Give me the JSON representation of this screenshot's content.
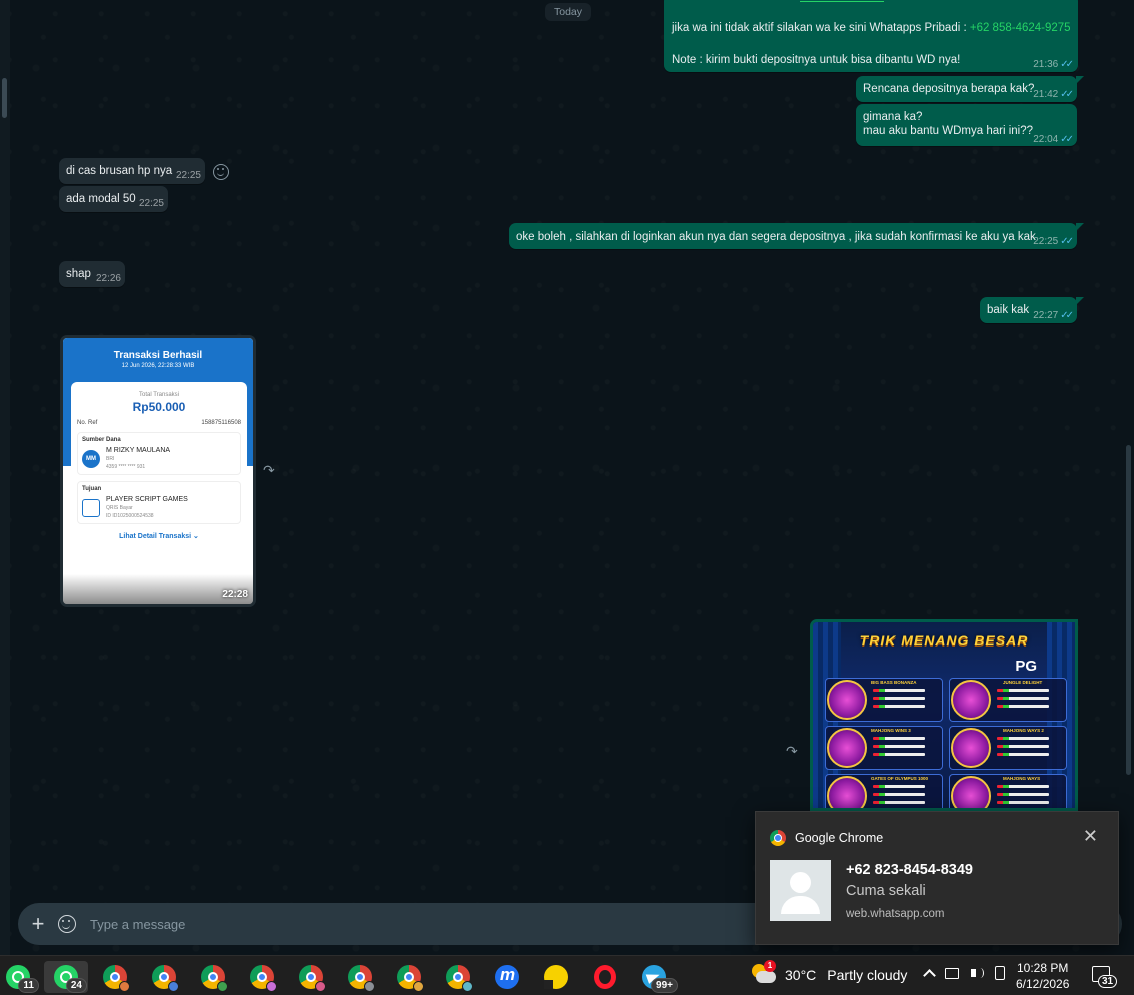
{
  "chat": {
    "day_chip": "Today",
    "messages": {
      "m1": {
        "text_a": "jika wa ini tidak aktif silakan wa ke sini Whatapps Pribadi : ",
        "phone": "+62 858-4624-9275",
        "text_b": "Note : kirim bukti depositnya untuk bisa dibantu WD nya!",
        "time": "21:36"
      },
      "m2": {
        "text": "Rencana depositnya berapa kak?",
        "time": "21:42"
      },
      "m3": {
        "line1": "gimana ka?",
        "line2": "mau aku bantu WDmya hari ini??",
        "time": "22:04"
      },
      "m4": {
        "text": "di cas brusan hp nya",
        "time": "22:25"
      },
      "m5": {
        "text": "ada modal 50",
        "time": "22:25"
      },
      "m6": {
        "text": "oke boleh , silahkan di loginkan akun nya dan segera depositnya , jika sudah konfirmasi ke aku ya kak",
        "time": "22:25"
      },
      "m7": {
        "text": "shap",
        "time": "22:26"
      },
      "m8": {
        "text": "baik kak",
        "time": "22:27"
      }
    },
    "receipt": {
      "title": "Transaksi Berhasil",
      "datetime": "12 Jun 2026, 22:28:33 WIB",
      "total_label": "Total Transaksi",
      "total": "Rp50.000",
      "ref_label": "No. Ref",
      "ref": "158875116508",
      "source_label": "Sumber Dana",
      "source_initials": "MM",
      "source_name": "M RIZKY MAULANA",
      "source_bank": "BRI",
      "source_account": "4359 **** **** 931",
      "dest_label": "Tujuan",
      "dest_name": "PLAYER SCRIPT GAMES",
      "dest_type": "QRIS Bayar",
      "dest_id": "ID ID1025000524538",
      "detail_link": "Lihat Detail Transaksi ⌄",
      "time": "22:28"
    },
    "promo": {
      "title": "TRIK MENANG BESAR",
      "brand": "PG",
      "games": [
        "BIG BASS BONANZA",
        "JUNGLE DELIGHT",
        "MAHJONG WINS 3",
        "MAHJONG WAYS 2",
        "GATES OF OLYMPUS 1000",
        "MAHJONG WAYS"
      ]
    }
  },
  "composer": {
    "placeholder": "Type a message"
  },
  "notification": {
    "app": "Google Chrome",
    "sender": "+62 823-8454-8349",
    "text": "Cuma sekali",
    "site": "web.whatsapp.com"
  },
  "taskbar": {
    "whatsapp1_badge": "11",
    "whatsapp2_badge": "24",
    "telegram_badge": "99+",
    "weather_alert": "1",
    "temperature": "30°C",
    "condition": "Partly cloudy",
    "time": "10:28 PM",
    "date": "6/12/2026",
    "notification_count": "31"
  },
  "colors": {
    "outgoing_bubble": "#005c4b",
    "incoming_bubble": "#202c33",
    "read_ticks": "#53bdeb",
    "link_green": "#25d366"
  }
}
